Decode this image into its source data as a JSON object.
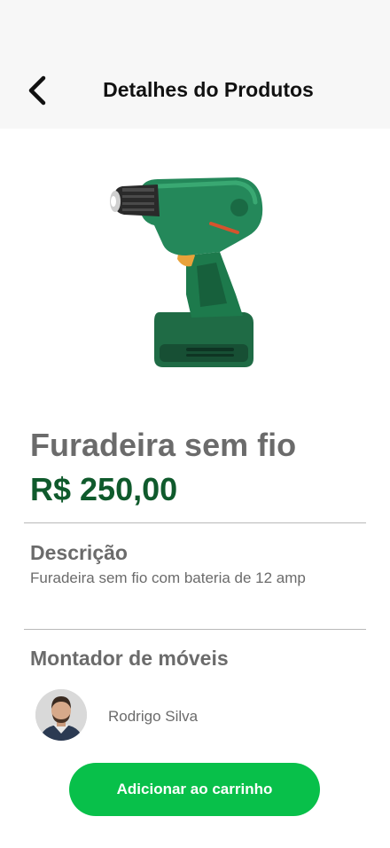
{
  "header": {
    "title": "Detalhes do Produtos",
    "back_icon": "chevron-left-icon"
  },
  "product": {
    "name": "Furadeira sem fio",
    "price": "R$ 250,00",
    "image": "cordless-drill"
  },
  "description": {
    "title": "Descrição",
    "text": "Furadeira sem fio com bateria de 12 amp"
  },
  "provider": {
    "title": "Montador de móveis",
    "name": "Rodrigo Silva"
  },
  "actions": {
    "add_to_cart_label": "Adicionar ao carrinho"
  },
  "colors": {
    "price_green": "#0f5a2c",
    "button_green": "#08c04a",
    "header_bg": "#f7f7f7",
    "text_gray": "#6b6b6b"
  }
}
